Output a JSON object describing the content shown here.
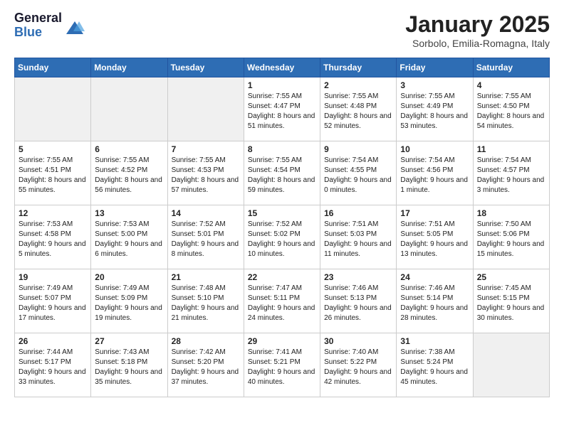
{
  "logo": {
    "general": "General",
    "blue": "Blue"
  },
  "header": {
    "month": "January 2025",
    "location": "Sorbolo, Emilia-Romagna, Italy"
  },
  "weekdays": [
    "Sunday",
    "Monday",
    "Tuesday",
    "Wednesday",
    "Thursday",
    "Friday",
    "Saturday"
  ],
  "weeks": [
    [
      {
        "day": "",
        "info": ""
      },
      {
        "day": "",
        "info": ""
      },
      {
        "day": "",
        "info": ""
      },
      {
        "day": "1",
        "info": "Sunrise: 7:55 AM\nSunset: 4:47 PM\nDaylight: 8 hours and 51 minutes."
      },
      {
        "day": "2",
        "info": "Sunrise: 7:55 AM\nSunset: 4:48 PM\nDaylight: 8 hours and 52 minutes."
      },
      {
        "day": "3",
        "info": "Sunrise: 7:55 AM\nSunset: 4:49 PM\nDaylight: 8 hours and 53 minutes."
      },
      {
        "day": "4",
        "info": "Sunrise: 7:55 AM\nSunset: 4:50 PM\nDaylight: 8 hours and 54 minutes."
      }
    ],
    [
      {
        "day": "5",
        "info": "Sunrise: 7:55 AM\nSunset: 4:51 PM\nDaylight: 8 hours and 55 minutes."
      },
      {
        "day": "6",
        "info": "Sunrise: 7:55 AM\nSunset: 4:52 PM\nDaylight: 8 hours and 56 minutes."
      },
      {
        "day": "7",
        "info": "Sunrise: 7:55 AM\nSunset: 4:53 PM\nDaylight: 8 hours and 57 minutes."
      },
      {
        "day": "8",
        "info": "Sunrise: 7:55 AM\nSunset: 4:54 PM\nDaylight: 8 hours and 59 minutes."
      },
      {
        "day": "9",
        "info": "Sunrise: 7:54 AM\nSunset: 4:55 PM\nDaylight: 9 hours and 0 minutes."
      },
      {
        "day": "10",
        "info": "Sunrise: 7:54 AM\nSunset: 4:56 PM\nDaylight: 9 hours and 1 minute."
      },
      {
        "day": "11",
        "info": "Sunrise: 7:54 AM\nSunset: 4:57 PM\nDaylight: 9 hours and 3 minutes."
      }
    ],
    [
      {
        "day": "12",
        "info": "Sunrise: 7:53 AM\nSunset: 4:58 PM\nDaylight: 9 hours and 5 minutes."
      },
      {
        "day": "13",
        "info": "Sunrise: 7:53 AM\nSunset: 5:00 PM\nDaylight: 9 hours and 6 minutes."
      },
      {
        "day": "14",
        "info": "Sunrise: 7:52 AM\nSunset: 5:01 PM\nDaylight: 9 hours and 8 minutes."
      },
      {
        "day": "15",
        "info": "Sunrise: 7:52 AM\nSunset: 5:02 PM\nDaylight: 9 hours and 10 minutes."
      },
      {
        "day": "16",
        "info": "Sunrise: 7:51 AM\nSunset: 5:03 PM\nDaylight: 9 hours and 11 minutes."
      },
      {
        "day": "17",
        "info": "Sunrise: 7:51 AM\nSunset: 5:05 PM\nDaylight: 9 hours and 13 minutes."
      },
      {
        "day": "18",
        "info": "Sunrise: 7:50 AM\nSunset: 5:06 PM\nDaylight: 9 hours and 15 minutes."
      }
    ],
    [
      {
        "day": "19",
        "info": "Sunrise: 7:49 AM\nSunset: 5:07 PM\nDaylight: 9 hours and 17 minutes."
      },
      {
        "day": "20",
        "info": "Sunrise: 7:49 AM\nSunset: 5:09 PM\nDaylight: 9 hours and 19 minutes."
      },
      {
        "day": "21",
        "info": "Sunrise: 7:48 AM\nSunset: 5:10 PM\nDaylight: 9 hours and 21 minutes."
      },
      {
        "day": "22",
        "info": "Sunrise: 7:47 AM\nSunset: 5:11 PM\nDaylight: 9 hours and 24 minutes."
      },
      {
        "day": "23",
        "info": "Sunrise: 7:46 AM\nSunset: 5:13 PM\nDaylight: 9 hours and 26 minutes."
      },
      {
        "day": "24",
        "info": "Sunrise: 7:46 AM\nSunset: 5:14 PM\nDaylight: 9 hours and 28 minutes."
      },
      {
        "day": "25",
        "info": "Sunrise: 7:45 AM\nSunset: 5:15 PM\nDaylight: 9 hours and 30 minutes."
      }
    ],
    [
      {
        "day": "26",
        "info": "Sunrise: 7:44 AM\nSunset: 5:17 PM\nDaylight: 9 hours and 33 minutes."
      },
      {
        "day": "27",
        "info": "Sunrise: 7:43 AM\nSunset: 5:18 PM\nDaylight: 9 hours and 35 minutes."
      },
      {
        "day": "28",
        "info": "Sunrise: 7:42 AM\nSunset: 5:20 PM\nDaylight: 9 hours and 37 minutes."
      },
      {
        "day": "29",
        "info": "Sunrise: 7:41 AM\nSunset: 5:21 PM\nDaylight: 9 hours and 40 minutes."
      },
      {
        "day": "30",
        "info": "Sunrise: 7:40 AM\nSunset: 5:22 PM\nDaylight: 9 hours and 42 minutes."
      },
      {
        "day": "31",
        "info": "Sunrise: 7:38 AM\nSunset: 5:24 PM\nDaylight: 9 hours and 45 minutes."
      },
      {
        "day": "",
        "info": ""
      }
    ]
  ]
}
